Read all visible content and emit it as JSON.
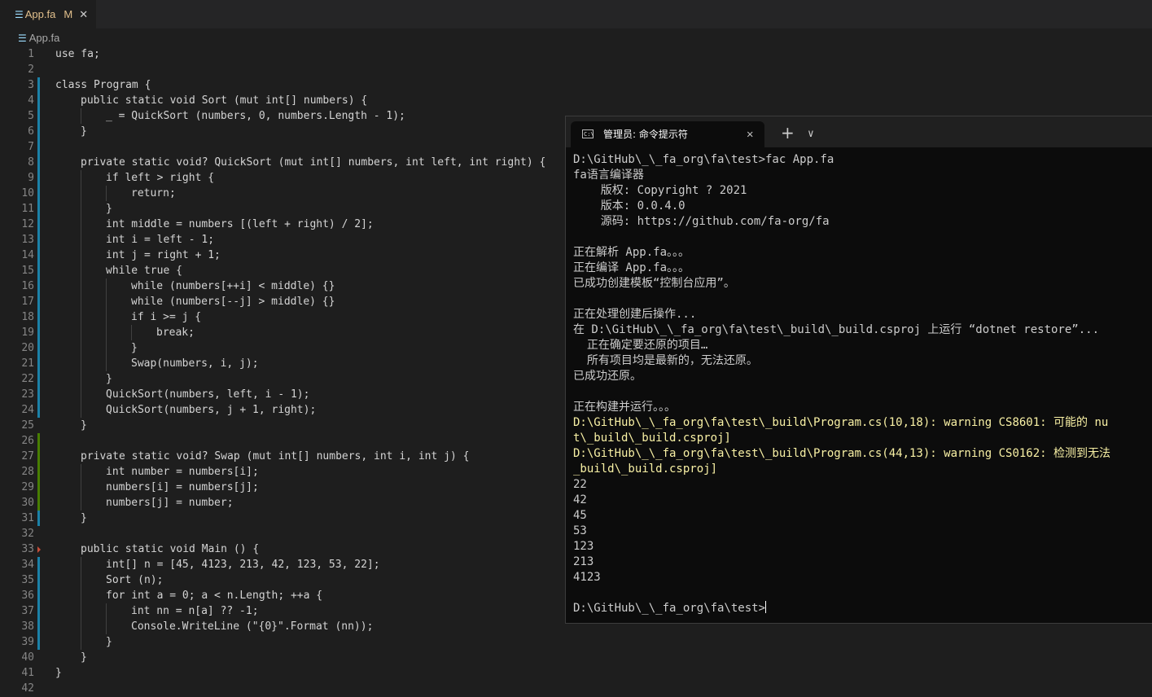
{
  "editor": {
    "tab": {
      "icon": "file-lines-icon",
      "name": "App.fa",
      "status": "M",
      "close": "✕"
    },
    "breadcrumb": "App.fa",
    "lines": [
      {
        "n": "1",
        "indent": 0,
        "gutter": "",
        "text": "use fa;"
      },
      {
        "n": "2",
        "indent": 0,
        "gutter": "",
        "text": ""
      },
      {
        "n": "3",
        "indent": 0,
        "gutter": "mod",
        "text": "class Program {"
      },
      {
        "n": "4",
        "indent": 1,
        "gutter": "mod",
        "text": "public static void Sort (mut int[] numbers) {"
      },
      {
        "n": "5",
        "indent": 2,
        "gutter": "mod",
        "text": "_ = QuickSort (numbers, 0, numbers.Length - 1);"
      },
      {
        "n": "6",
        "indent": 1,
        "gutter": "mod",
        "text": "}"
      },
      {
        "n": "7",
        "indent": 0,
        "gutter": "mod",
        "text": ""
      },
      {
        "n": "8",
        "indent": 1,
        "gutter": "mod",
        "text": "private static void? QuickSort (mut int[] numbers, int left, int right) {"
      },
      {
        "n": "9",
        "indent": 2,
        "gutter": "mod",
        "text": "if left > right {"
      },
      {
        "n": "10",
        "indent": 3,
        "gutter": "mod",
        "text": "return;"
      },
      {
        "n": "11",
        "indent": 2,
        "gutter": "mod",
        "text": "}"
      },
      {
        "n": "12",
        "indent": 2,
        "gutter": "mod",
        "text": "int middle = numbers [(left + right) / 2];"
      },
      {
        "n": "13",
        "indent": 2,
        "gutter": "mod",
        "text": "int i = left - 1;"
      },
      {
        "n": "14",
        "indent": 2,
        "gutter": "mod",
        "text": "int j = right + 1;"
      },
      {
        "n": "15",
        "indent": 2,
        "gutter": "mod",
        "text": "while true {"
      },
      {
        "n": "16",
        "indent": 3,
        "gutter": "mod",
        "text": "while (numbers[++i] < middle) {}"
      },
      {
        "n": "17",
        "indent": 3,
        "gutter": "mod",
        "text": "while (numbers[--j] > middle) {}"
      },
      {
        "n": "18",
        "indent": 3,
        "gutter": "mod",
        "text": "if i >= j {"
      },
      {
        "n": "19",
        "indent": 4,
        "gutter": "mod",
        "text": "break;"
      },
      {
        "n": "20",
        "indent": 3,
        "gutter": "mod",
        "text": "}"
      },
      {
        "n": "21",
        "indent": 3,
        "gutter": "mod",
        "text": "Swap(numbers, i, j);"
      },
      {
        "n": "22",
        "indent": 2,
        "gutter": "mod",
        "text": "}"
      },
      {
        "n": "23",
        "indent": 2,
        "gutter": "mod",
        "text": "QuickSort(numbers, left, i - 1);"
      },
      {
        "n": "24",
        "indent": 2,
        "gutter": "mod",
        "text": "QuickSort(numbers, j + 1, right);"
      },
      {
        "n": "25",
        "indent": 1,
        "gutter": "",
        "text": "}"
      },
      {
        "n": "26",
        "indent": 0,
        "gutter": "add",
        "text": ""
      },
      {
        "n": "27",
        "indent": 1,
        "gutter": "add",
        "text": "private static void? Swap (mut int[] numbers, int i, int j) {"
      },
      {
        "n": "28",
        "indent": 2,
        "gutter": "add",
        "text": "int number = numbers[i];"
      },
      {
        "n": "29",
        "indent": 2,
        "gutter": "add",
        "text": "numbers[i] = numbers[j];"
      },
      {
        "n": "30",
        "indent": 2,
        "gutter": "add",
        "text": "numbers[j] = number;"
      },
      {
        "n": "31",
        "indent": 1,
        "gutter": "mod",
        "text": "}"
      },
      {
        "n": "32",
        "indent": 0,
        "gutter": "",
        "text": ""
      },
      {
        "n": "33",
        "indent": 1,
        "gutter": "del",
        "text": "public static void Main () {"
      },
      {
        "n": "34",
        "indent": 2,
        "gutter": "mod",
        "text": "int[] n = [45, 4123, 213, 42, 123, 53, 22];"
      },
      {
        "n": "35",
        "indent": 2,
        "gutter": "mod",
        "text": "Sort (n);"
      },
      {
        "n": "36",
        "indent": 2,
        "gutter": "mod",
        "text": "for int a = 0; a < n.Length; ++a {"
      },
      {
        "n": "37",
        "indent": 3,
        "gutter": "mod",
        "text": "int nn = n[a] ?? -1;"
      },
      {
        "n": "38",
        "indent": 3,
        "gutter": "mod",
        "text": "Console.WriteLine (\"{0}\".Format (nn));"
      },
      {
        "n": "39",
        "indent": 2,
        "gutter": "mod",
        "text": "}"
      },
      {
        "n": "40",
        "indent": 1,
        "gutter": "",
        "text": "}"
      },
      {
        "n": "41",
        "indent": 0,
        "gutter": "",
        "text": "}"
      },
      {
        "n": "42",
        "indent": 0,
        "gutter": "",
        "text": ""
      }
    ]
  },
  "terminal": {
    "tab_icon": "cmd-icon",
    "tab_icon_text": "C:\\",
    "tab_title": "管理员: 命令提示符",
    "tab_close": "✕",
    "new_tab": "+",
    "dropdown": "∨",
    "lines": [
      {
        "text": "D:\\GitHub\\_\\_fa_org\\fa\\test>fac App.fa",
        "style": ""
      },
      {
        "text": "fa语言编译器",
        "style": ""
      },
      {
        "text": "    版权: Copyright ? 2021",
        "style": ""
      },
      {
        "text": "    版本: 0.0.4.0",
        "style": ""
      },
      {
        "text": "    源码: https://github.com/fa-org/fa",
        "style": ""
      },
      {
        "text": "",
        "style": ""
      },
      {
        "text": "正在解析 App.fa。。。",
        "style": ""
      },
      {
        "text": "正在编译 App.fa。。。",
        "style": ""
      },
      {
        "text": "已成功创建模板“控制台应用”。",
        "style": ""
      },
      {
        "text": "",
        "style": ""
      },
      {
        "text": "正在处理创建后操作...",
        "style": ""
      },
      {
        "text": "在 D:\\GitHub\\_\\_fa_org\\fa\\test\\_build\\_build.csproj 上运行 “dotnet restore”...",
        "style": ""
      },
      {
        "text": "  正在确定要还原的项目…",
        "style": ""
      },
      {
        "text": "  所有项目均是最新的，无法还原。",
        "style": ""
      },
      {
        "text": "已成功还原。",
        "style": ""
      },
      {
        "text": "",
        "style": ""
      },
      {
        "text": "正在构建并运行。。。",
        "style": ""
      },
      {
        "text": "D:\\GitHub\\_\\_fa_org\\fa\\test\\_build\\Program.cs(10,18): warning CS8601: 可能的 nu",
        "style": "warn"
      },
      {
        "text": "t\\_build\\_build.csproj]",
        "style": "warn"
      },
      {
        "text": "D:\\GitHub\\_\\_fa_org\\fa\\test\\_build\\Program.cs(44,13): warning CS0162: 检测到无法",
        "style": "warn"
      },
      {
        "text": "_build\\_build.csproj]",
        "style": "warn"
      },
      {
        "text": "22",
        "style": ""
      },
      {
        "text": "42",
        "style": ""
      },
      {
        "text": "45",
        "style": ""
      },
      {
        "text": "53",
        "style": ""
      },
      {
        "text": "123",
        "style": ""
      },
      {
        "text": "213",
        "style": ""
      },
      {
        "text": "4123",
        "style": ""
      },
      {
        "text": "",
        "style": ""
      }
    ],
    "prompt": "D:\\GitHub\\_\\_fa_org\\fa\\test>"
  },
  "colors": {
    "editor_bg": "#1e1e1e",
    "gutter_modified": "#1b81a8",
    "gutter_added": "#487e02",
    "gutter_deleted": "#c74e39",
    "terminal_bg": "#0c0c0c",
    "terminal_warning": "#f9f1a5"
  }
}
